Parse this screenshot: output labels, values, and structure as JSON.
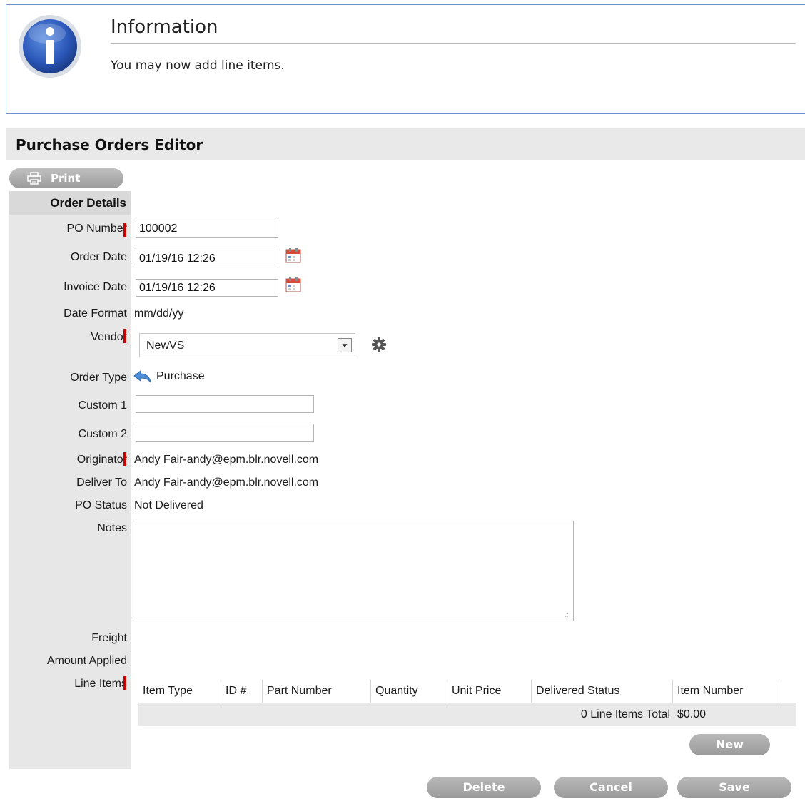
{
  "info": {
    "title": "Information",
    "message": "You may now add line items."
  },
  "editor": {
    "title": "Purchase Orders Editor",
    "print_label": "Print",
    "section_header": "Order Details"
  },
  "form": {
    "po_number": {
      "label": "PO Number",
      "value": "100002"
    },
    "order_date": {
      "label": "Order Date",
      "value": "01/19/16 12:26"
    },
    "invoice_date": {
      "label": "Invoice Date",
      "value": "01/19/16 12:26"
    },
    "date_format": {
      "label": "Date Format",
      "value": "mm/dd/yy"
    },
    "vendor": {
      "label": "Vendor",
      "value": "NewVS"
    },
    "order_type": {
      "label": "Order Type",
      "value": "Purchase"
    },
    "custom1": {
      "label": "Custom 1",
      "value": ""
    },
    "custom2": {
      "label": "Custom 2",
      "value": ""
    },
    "originator": {
      "label": "Originator",
      "value": "Andy Fair-andy@epm.blr.novell.com"
    },
    "deliver_to": {
      "label": "Deliver To",
      "value": "Andy Fair-andy@epm.blr.novell.com"
    },
    "po_status": {
      "label": "PO Status",
      "value": "Not Delivered"
    },
    "notes": {
      "label": "Notes",
      "value": ""
    },
    "freight": {
      "label": "Freight"
    },
    "amount_applied": {
      "label": "Amount Applied"
    },
    "line_items": {
      "label": "Line Items"
    }
  },
  "line_items": {
    "columns": [
      "Item Type",
      "ID #",
      "Part Number",
      "Quantity",
      "Unit Price",
      "Delivered Status",
      "Item Number"
    ],
    "total_label": "0 Line Items Total",
    "total_value": "$0.00",
    "new_label": "New"
  },
  "actions": {
    "delete": "Delete",
    "cancel": "Cancel",
    "save": "Save"
  },
  "colors": {
    "required_marker": "#cc0000",
    "button_gray": "#a8a8a8",
    "info_border": "#6d8fc9"
  }
}
